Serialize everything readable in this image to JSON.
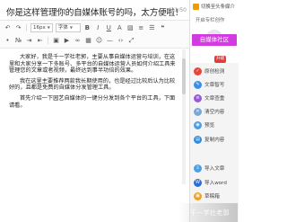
{
  "editor": {
    "title": "你是这样管理你的自媒体账号的吗，太方便啦！",
    "char_count": "21/50",
    "toolbar": {
      "font_size_value": "16px",
      "font_family_value": "字体",
      "row1_icons": [
        "undo-icon",
        "redo-icon",
        "bold-icon",
        "italic-icon",
        "underline-icon",
        "strike-icon",
        "font-color-icon",
        "bg-color-icon",
        "clear-format-icon",
        "align-left-icon",
        "align-center-icon",
        "align-right-icon",
        "align-justify-icon",
        "quote-icon"
      ],
      "row2_icons": [
        "list-ul-icon",
        "list-ol-icon",
        "indent-icon",
        "outdent-icon",
        "image-icon",
        "video-icon",
        "link-icon",
        "table-icon",
        "emoji-icon",
        "hr-icon",
        "code-icon",
        "fullscreen-icon"
      ]
    },
    "paragraphs": [
      "大家好，我是千一学社老郭，主要从事自媒体运营与培训，在这里和大家分享一下多账号、多平台的自媒体运营人员如何介绍工具来管理您的文章或者视频，最终达到事半功倍的效果。",
      "我在这里主要推荐两款我长期使用的，也是经过比较后认为比较好的，且都是免费的自媒体分发管理工具。",
      "首先介绍一下园艺自媒体的一键分分发到各个平台的工具，下面请看。"
    ]
  },
  "sidebar": {
    "top_label": "切换至头条媒介",
    "sub_label": "开启专栏创作",
    "brand": "自媒体社区",
    "badge": "升级",
    "items": [
      {
        "label": "原创检测",
        "icon": "check-icon",
        "color": "#e8443a",
        "glyph": "✓"
      },
      {
        "label": "文章智写",
        "icon": "pen-icon",
        "color": "#3b8ee8",
        "glyph": "✎"
      },
      {
        "label": "文章查重",
        "icon": "copy-icon",
        "color": "#9b59d6",
        "glyph": "≡"
      },
      {
        "label": "清空内容",
        "icon": "trash-icon",
        "color": "#7ba7d4",
        "glyph": "✕"
      },
      {
        "label": "预览",
        "icon": "eye-icon",
        "color": "#4a9ee0",
        "glyph": "◉"
      },
      {
        "label": "复制内容",
        "icon": "clipboard-icon",
        "color": "#2d8de0",
        "glyph": "▤"
      },
      {
        "label": "导入文章",
        "icon": "import-icon",
        "color": "#4aa0e6",
        "glyph": "⇩"
      },
      {
        "label": "导入word",
        "icon": "word-icon",
        "color": "#2b6fd6",
        "glyph": "W"
      },
      {
        "label": "草稿箱",
        "icon": "draft-icon",
        "color": "#f0a020",
        "glyph": "▣"
      }
    ]
  },
  "watermark": "千一学社老郭"
}
